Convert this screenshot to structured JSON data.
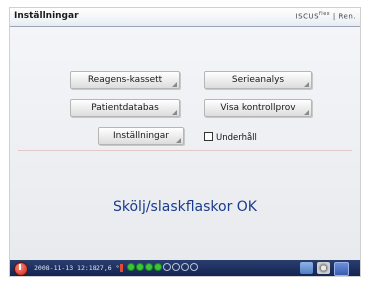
{
  "window": {
    "title": "Inställningar",
    "brand": "ISCUS",
    "brand_sup": "flex",
    "brand_suffix": "| Ren."
  },
  "buttons": {
    "reagens": "Reagens-kassett",
    "serie": "Serieanalys",
    "patient": "Patientdatabas",
    "kontroll": "Visa kontrollprov",
    "installningar": "Inställningar"
  },
  "checkbox": {
    "label": "Underhåll",
    "checked": false
  },
  "status_message": "Skölj/slaskflaskor OK",
  "taskbar": {
    "datetime": "2008-11-13 12:18",
    "temperature": "27,6 °C",
    "indicators_on": 4,
    "indicators_off": 4,
    "icons": [
      "keyboard-icon",
      "settings-icon",
      "folder-icon"
    ],
    "accent_color": "#2a3e6e"
  }
}
